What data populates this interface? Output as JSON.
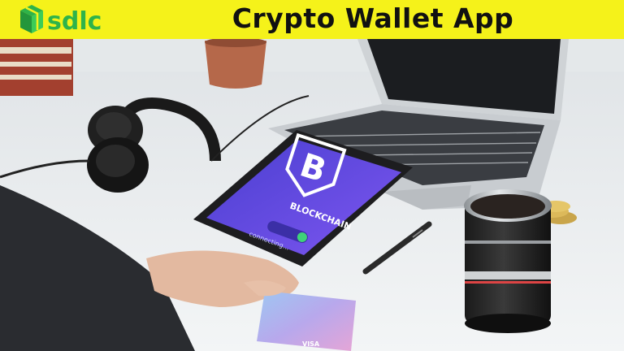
{
  "banner": {
    "logo_text": "sdlc",
    "title": "Crypto Wallet App",
    "background_color": "#f5f21a"
  },
  "photo": {
    "tablet_screen": {
      "brand_label": "BLOCKCHAIN",
      "status_label": "connecting...",
      "accent_color": "#5b4ce6",
      "toggle_color": "#3fd27a"
    },
    "card": {
      "brand": "VISA"
    }
  },
  "colors": {
    "logo_green": "#2fb34a",
    "desk": "#eef1f2"
  }
}
